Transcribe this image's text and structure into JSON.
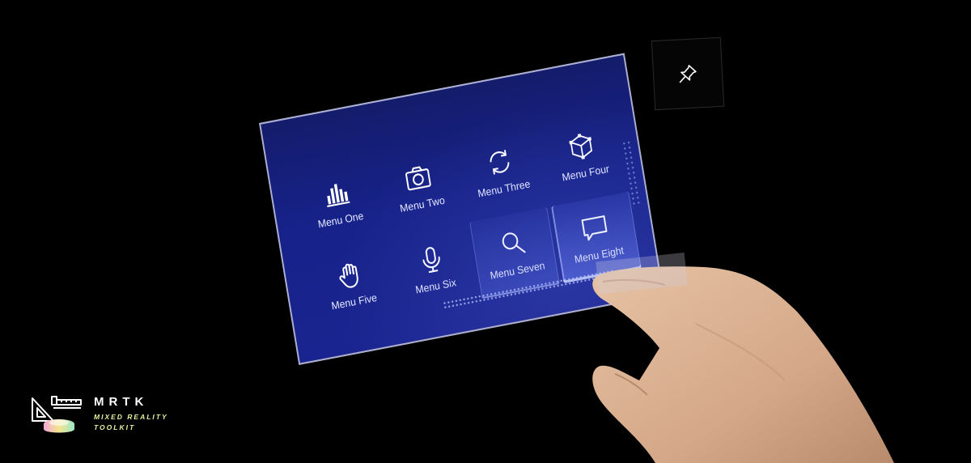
{
  "menu": {
    "items": [
      {
        "label": "Menu One",
        "icon": "bar-chart-icon"
      },
      {
        "label": "Menu Two",
        "icon": "camera-icon"
      },
      {
        "label": "Menu Three",
        "icon": "refresh-icon"
      },
      {
        "label": "Menu Four",
        "icon": "cube-icon"
      },
      {
        "label": "Menu Five",
        "icon": "hand-icon"
      },
      {
        "label": "Menu Six",
        "icon": "microphone-icon"
      },
      {
        "label": "Menu Seven",
        "icon": "search-icon"
      },
      {
        "label": "Menu Eight",
        "icon": "speech-bubble-icon"
      }
    ]
  },
  "pin": {
    "icon": "pin-icon"
  },
  "logo": {
    "title": "MRTK",
    "subtitle_line1": "MIXED REALITY",
    "subtitle_line2": "TOOLKIT"
  },
  "colors": {
    "panel": "#17228a",
    "panel_border": "#c8c8dc",
    "background": "#000000",
    "logo_accent": "#e8f0a0"
  }
}
